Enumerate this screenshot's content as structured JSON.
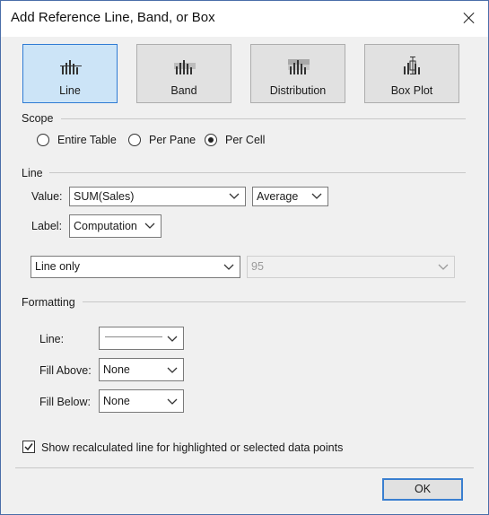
{
  "dialog": {
    "title": "Add Reference Line, Band, or Box"
  },
  "types": [
    {
      "label": "Line",
      "selected": true
    },
    {
      "label": "Band",
      "selected": false
    },
    {
      "label": "Distribution",
      "selected": false
    },
    {
      "label": "Box Plot",
      "selected": false
    }
  ],
  "scope": {
    "label": "Scope",
    "options": [
      {
        "label": "Entire Table",
        "checked": false
      },
      {
        "label": "Per Pane",
        "checked": false
      },
      {
        "label": "Per Cell",
        "checked": true
      }
    ]
  },
  "line": {
    "label": "Line",
    "value_label": "Value:",
    "value": "SUM(Sales)",
    "aggregation": "Average",
    "label_label": "Label:",
    "label_value": "Computation",
    "interval_type": "Line only",
    "confidence": "95"
  },
  "formatting": {
    "label": "Formatting",
    "line_label": "Line:",
    "fill_above_label": "Fill Above:",
    "fill_above": "None",
    "fill_below_label": "Fill Below:",
    "fill_below": "None"
  },
  "recalc": {
    "label": "Show recalculated line for highlighted or selected data points",
    "checked": true
  },
  "buttons": {
    "ok": "OK"
  }
}
